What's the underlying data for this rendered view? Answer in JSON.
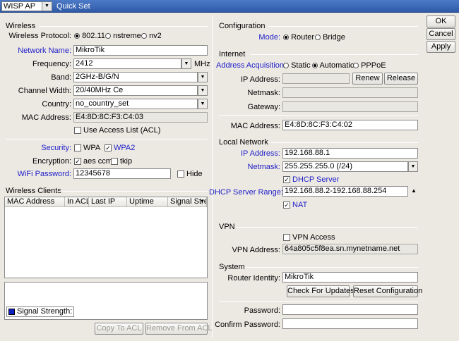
{
  "window": {
    "mode": "WISP AP",
    "title": "Quick Set"
  },
  "buttons": {
    "ok": "OK",
    "cancel": "Cancel",
    "apply": "Apply"
  },
  "wireless": {
    "section": "Wireless",
    "protocol_label": "Wireless Protocol:",
    "protocol_options": [
      "802.11",
      "nstreme",
      "nv2"
    ],
    "network_name_label": "Network Name:",
    "network_name": "MikroTik",
    "frequency_label": "Frequency:",
    "frequency": "2412",
    "frequency_unit": "MHz",
    "band_label": "Band:",
    "band": "2GHz-B/G/N",
    "channel_width_label": "Channel Width:",
    "channel_width": "20/40MHz Ce",
    "country_label": "Country:",
    "country": "no_country_set",
    "mac_label": "MAC Address:",
    "mac": "E4:8D:8C:F3:C4:03",
    "use_acl_label": "Use Access List (ACL)",
    "security_label": "Security:",
    "sec_wpa": "WPA",
    "sec_wpa2": "WPA2",
    "encryption_label": "Encryption:",
    "enc_aes": "aes ccm",
    "enc_tkip": "tkip",
    "password_label": "WiFi Password:",
    "password": "12345678",
    "hide_label": "Hide"
  },
  "clients": {
    "section": "Wireless Clients",
    "columns": [
      "MAC Address",
      "In ACL",
      "Last IP",
      "Uptime",
      "Signal Stren"
    ],
    "legend_label": "Signal Strength:",
    "legend_color": "#1020c0",
    "copy_acl": "Copy To ACL",
    "remove_acl": "Remove From ACL"
  },
  "configuration": {
    "section": "Configuration",
    "mode_label": "Mode:",
    "mode_router": "Router",
    "mode_bridge": "Bridge"
  },
  "internet": {
    "section": "Internet",
    "acq_label": "Address Acquisition:",
    "acq_static": "Static",
    "acq_auto": "Automatic",
    "acq_pppoe": "PPPoE",
    "ip_label": "IP Address:",
    "renew": "Renew",
    "release": "Release",
    "netmask_label": "Netmask:",
    "gateway_label": "Gateway:",
    "mac_label": "MAC Address:",
    "mac": "E4:8D:8C:F3:C4:02"
  },
  "local": {
    "section": "Local Network",
    "ip_label": "IP Address:",
    "ip": "192.168.88.1",
    "netmask_label": "Netmask:",
    "netmask": "255.255.255.0 (/24)",
    "dhcp_server": "DHCP Server",
    "range_label": "DHCP Server Range:",
    "range": "192.168.88.2-192.168.88.254",
    "nat": "NAT"
  },
  "vpn": {
    "section": "VPN",
    "access_label": "VPN Access",
    "address_label": "VPN Address:",
    "address": "64a805c5f8ea.sn.mynetname.net"
  },
  "system": {
    "section": "System",
    "identity_label": "Router Identity:",
    "identity": "MikroTik",
    "check_updates": "Check For Updates",
    "reset_config": "Reset Configuration",
    "password_label": "Password:",
    "confirm_label": "Confirm Password:"
  }
}
